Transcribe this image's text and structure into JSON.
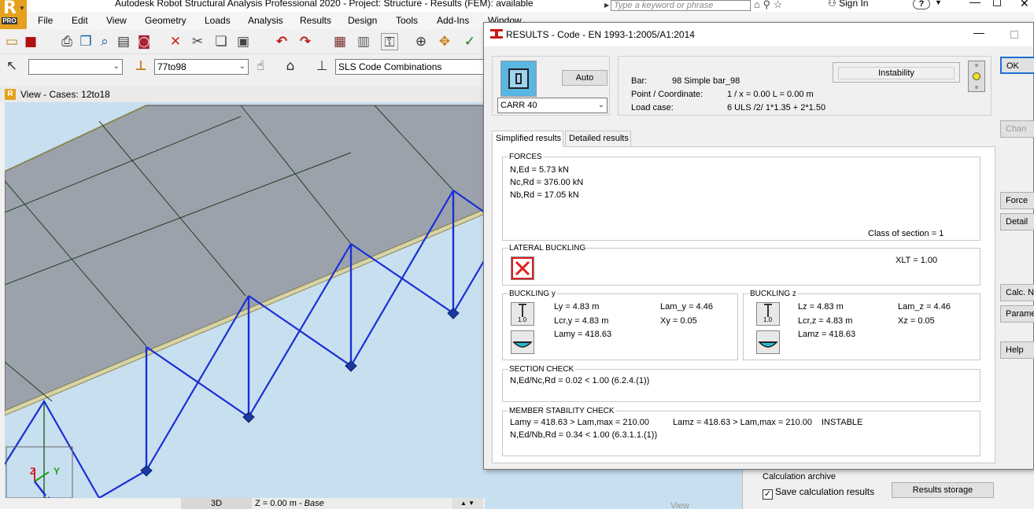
{
  "app": {
    "title": "Autodesk Robot Structural Analysis Professional 2020 - Project: Structure - Results (FEM): available",
    "logo_letter": "R",
    "logo_badge": "PRO",
    "search_placeholder": "Type a keyword or phrase",
    "sign_in": "Sign In",
    "help_label": "?"
  },
  "menu": [
    "File",
    "Edit",
    "View",
    "Geometry",
    "Loads",
    "Analysis",
    "Results",
    "Design",
    "Tools",
    "Add-Ins",
    "Window"
  ],
  "toolbar2": {
    "combo1_value": "",
    "combo2_value": "77to98",
    "combo3_value": "SLS Code Combinations"
  },
  "view": {
    "header": "View - Cases: 12to18",
    "status_mode": "3D",
    "status_z_prefix": "Z = 0.00 m - ",
    "status_z_plane": "Base",
    "bg_view_label": "View",
    "axis_z": "Z",
    "axis_y": "Y",
    "axis_x": "X"
  },
  "bottom_panel": {
    "calc_archive_label": "Calculation archive",
    "save_calc_label": "Save calculation results",
    "save_calc_checked": true,
    "results_storage_label": "Results storage"
  },
  "dialog": {
    "title": "RESULTS - Code - EN 1993-1:2005/A1:2014",
    "auto_button": "Auto",
    "section_select": "CARR 40",
    "bar_label": "Bar:",
    "bar_value": "98  Simple bar_98",
    "point_label": "Point / Coordinate:",
    "point_value": "1 / x = 0.00 L = 0.00 m",
    "loadcase_label": "Load case:",
    "loadcase_value": "6 ULS /2/  1*1.35 + 2*1.50",
    "instability_label": "Instability",
    "tabs": [
      "Simplified results",
      "Detailed results"
    ],
    "active_tab": 0,
    "forces": {
      "title": "FORCES",
      "lines": [
        "N,Ed = 5.73 kN",
        "Nc,Rd = 376.00 kN",
        "Nb,Rd = 17.05 kN"
      ],
      "class_of_section": "Class of section = 1"
    },
    "lateral_buckling": {
      "title": "LATERAL BUCKLING",
      "xlt": "XLT = 1.00"
    },
    "buckling_y": {
      "title": "BUCKLING y",
      "icon_value": "1.0",
      "l1": "Ly = 4.83 m",
      "l2": "Lcr,y = 4.83 m",
      "l3": "Lamy = 418.63",
      "r1": "Lam_y = 4.46",
      "r2": "Xy = 0.05"
    },
    "buckling_z": {
      "title": "BUCKLING z",
      "icon_value": "1.0",
      "l1": "Lz = 4.83 m",
      "l2": "Lcr,z = 4.83 m",
      "l3": "Lamz = 418.63",
      "r1": "Lam_z = 4.46",
      "r2": "Xz = 0.05"
    },
    "section_check": {
      "title": "SECTION CHECK",
      "line": "N,Ed/Nc,Rd = 0.02 < 1.00   (6.2.4.(1))"
    },
    "member_stability": {
      "title": "MEMBER STABILITY CHECK",
      "line1a": "Lamy = 418.63 > Lam,max = 210.00",
      "line1b": "Lamz = 418.63 > Lam,max = 210.00",
      "line1c": "INSTABLE",
      "line2": "N,Ed/Nb,Rd = 0.34 < 1.00   (6.3.1.1.(1))"
    },
    "right_buttons": [
      "OK",
      "Chan",
      "Force",
      "Detail",
      "Calc. N",
      "Parame",
      "Help"
    ]
  },
  "colors": {
    "member_blue": "#1a2fd6",
    "slab_gray": "#9ca2ac",
    "viewport_bg": "#c8dff0",
    "indicator_yellow": "#f0e020",
    "fail_red": "#e02020"
  }
}
